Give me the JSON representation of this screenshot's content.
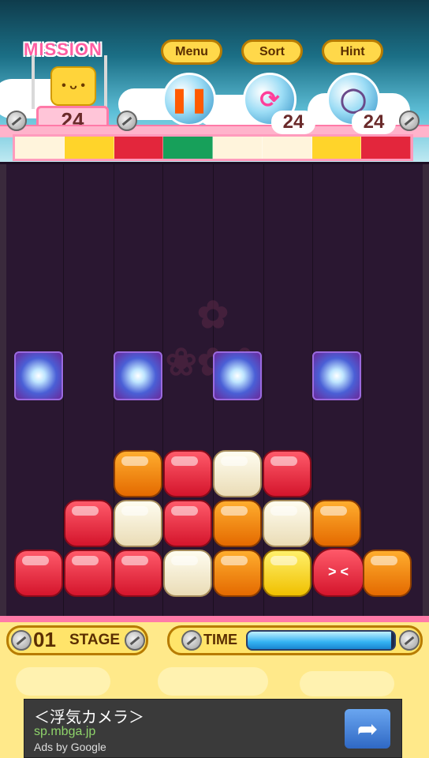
{
  "header": {
    "mission_title": "MISSION",
    "mission_count": "24",
    "buttons": {
      "menu_label": "Menu",
      "sort_label": "Sort",
      "hint_label": "Hint"
    },
    "sort_count": "24",
    "hint_count": "24"
  },
  "status": {
    "stage_number": "01",
    "stage_label": "STAGE",
    "time_label": "TIME",
    "time_fraction": 0.98
  },
  "ad": {
    "title": "＜浮気カメラ＞",
    "url": "sp.mbga.jp",
    "by": "Ads by Google"
  },
  "colors": {
    "red": "#e3263c",
    "orange": "#f58a10",
    "cream": "#f6efd6",
    "yellow": "#ffd42a",
    "gem": "#4a5fd6"
  }
}
